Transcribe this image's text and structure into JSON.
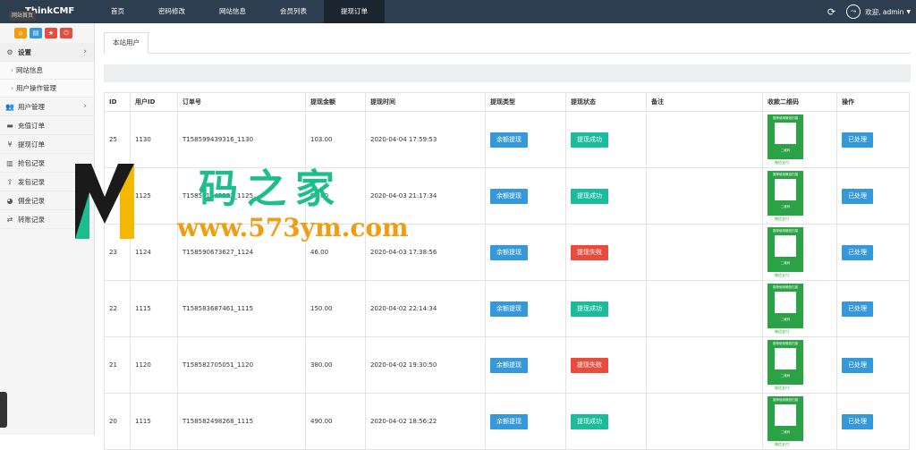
{
  "header": {
    "brand": "ThinkCMF",
    "tooltip": "网站首页",
    "nav": [
      {
        "label": "首页",
        "active": false
      },
      {
        "label": "密码修改",
        "active": false
      },
      {
        "label": "网站信息",
        "active": false
      },
      {
        "label": "会员列表",
        "active": false
      },
      {
        "label": "提现订单",
        "active": true
      }
    ],
    "welcome": "欢迎, admin"
  },
  "sidebar": {
    "shortcut_colors": [
      "#f39c12",
      "#3498db",
      "#e74c3c",
      "#e74c3c"
    ],
    "settings_label": "设置",
    "settings_sub": [
      "网站信息",
      "用户操作管理"
    ],
    "items": [
      {
        "label": "用户管理",
        "icon": "users-icon"
      },
      {
        "label": "充值订单",
        "icon": "chart-icon"
      },
      {
        "label": "提现订单",
        "icon": "yen-icon"
      },
      {
        "label": "抢包记录",
        "icon": "bar-chart-icon"
      },
      {
        "label": "发包记录",
        "icon": "upload-icon"
      },
      {
        "label": "佣金记录",
        "icon": "pie-chart-icon"
      },
      {
        "label": "转账记录",
        "icon": "transfer-icon"
      }
    ]
  },
  "main": {
    "tab": "本站用户",
    "columns": [
      "ID",
      "用户ID",
      "订单号",
      "提现金额",
      "提现时间",
      "提现类型",
      "提现状态",
      "备注",
      "收款二维码",
      "操作"
    ],
    "rows": [
      {
        "id": "25",
        "uid": "1130",
        "order": "T158599439316_1130",
        "amount": "103.00",
        "time": "2020-04-04 17:59:53",
        "type": "余额提现",
        "status": "提现成功",
        "ok": true,
        "note": "",
        "action": "已处理"
      },
      {
        "id": "24",
        "uid": "1125",
        "order": "T158591645233_1125",
        "amount": "90.00",
        "time": "2020-04-03 21:17:34",
        "type": "余额提现",
        "status": "提现成功",
        "ok": true,
        "note": "",
        "action": "已处理"
      },
      {
        "id": "23",
        "uid": "1124",
        "order": "T158590673627_1124",
        "amount": "46.00",
        "time": "2020-04-03 17:38:56",
        "type": "余额提现",
        "status": "提现失败",
        "ok": false,
        "note": "",
        "action": "已处理"
      },
      {
        "id": "22",
        "uid": "1115",
        "order": "T158583687461_1115",
        "amount": "150.00",
        "time": "2020-04-02 22:14:34",
        "type": "余额提现",
        "status": "提现成功",
        "ok": true,
        "note": "",
        "action": "已处理"
      },
      {
        "id": "21",
        "uid": "1120",
        "order": "T158582705051_1120",
        "amount": "380.00",
        "time": "2020-04-02 19:30:50",
        "type": "余额提现",
        "status": "提现失败",
        "ok": false,
        "note": "",
        "action": "已处理"
      },
      {
        "id": "20",
        "uid": "1115",
        "order": "T158582498268_1115",
        "amount": "490.00",
        "time": "2020-04-02 18:56:22",
        "type": "余额提现",
        "status": "提现成功",
        "ok": true,
        "note": "",
        "action": "已处理"
      }
    ],
    "qr_header": "推荐使用微信扫描",
    "qr_footer": "二维码",
    "qr_label": "微信支付"
  },
  "watermark": {
    "title": "码之家",
    "url": "www.573ym.com"
  }
}
